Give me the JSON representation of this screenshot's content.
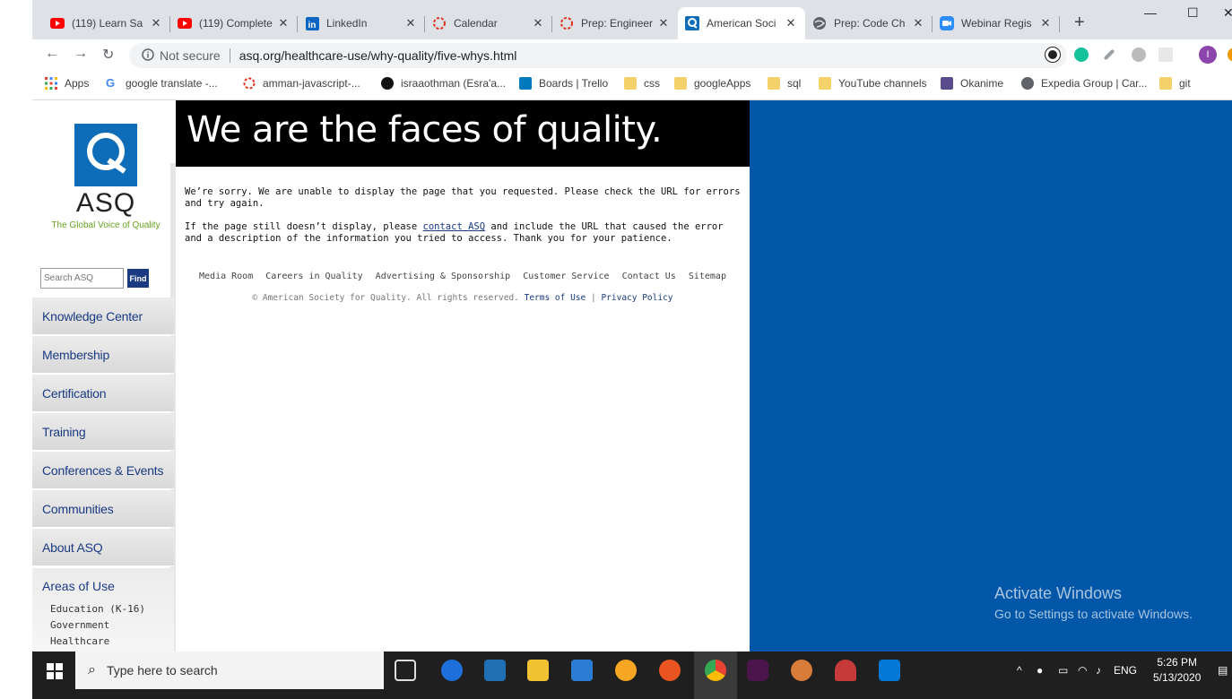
{
  "browser": {
    "tabs": [
      {
        "title": "(119) Learn Sa",
        "icon": "youtube-icon",
        "color": "#ff0000"
      },
      {
        "title": "(119) Complete",
        "icon": "youtube-icon",
        "color": "#ff0000"
      },
      {
        "title": "LinkedIn",
        "icon": "linkedin-icon",
        "color": "#0a66c2"
      },
      {
        "title": "Calendar",
        "icon": "hackerrank-icon",
        "color": "#e0301e"
      },
      {
        "title": "Prep: Engineer",
        "icon": "hackerrank-icon",
        "color": "#e0301e"
      },
      {
        "title": "American Soci",
        "icon": "asq-icon",
        "color": "#0d6db8"
      },
      {
        "title": "Prep: Code Ch",
        "icon": "globe-icon",
        "color": "#5f6368"
      },
      {
        "title": "Webinar Regis",
        "icon": "zoom-icon",
        "color": "#2d8cff"
      }
    ],
    "new_tab": "+",
    "window_controls": {
      "minimize": "—",
      "maximize": "☐",
      "close": "✕"
    },
    "not_secure": "Not secure",
    "url": "asq.org/healthcare-use/why-quality/five-whys.html",
    "bookmarks": [
      {
        "label": "Apps",
        "icon": "apps-grid-icon"
      },
      {
        "label": "google translate -...",
        "icon": "google-icon"
      },
      {
        "label": "amman-javascript-...",
        "icon": "hackerrank-icon"
      },
      {
        "label": "israaothman (Esra'a...",
        "icon": "github-icon"
      },
      {
        "label": "Boards | Trello",
        "icon": "trello-icon"
      },
      {
        "label": "css",
        "icon": "folder-icon"
      },
      {
        "label": "googleApps",
        "icon": "folder-icon"
      },
      {
        "label": "sql",
        "icon": "folder-icon"
      },
      {
        "label": "YouTube channels",
        "icon": "folder-icon"
      },
      {
        "label": "Okanime",
        "icon": "okanime-icon"
      },
      {
        "label": "Expedia Group | Car...",
        "icon": "globe-icon"
      },
      {
        "label": "git",
        "icon": "folder-icon"
      }
    ]
  },
  "site": {
    "logo_word": "ASQ",
    "logo_tagline": "The Global Voice of Quality",
    "search_placeholder": "Search ASQ",
    "search_button": "Find",
    "nav": [
      "Knowledge Center",
      "Membership",
      "Certification",
      "Training",
      "Conferences & Events",
      "Communities",
      "About ASQ"
    ],
    "areas_heading": "Areas of Use",
    "areas_items": [
      "Education (K-16)",
      "Government",
      "Healthcare"
    ],
    "banner": "We are the faces of quality.",
    "error_line1": "We’re sorry. We are unable to display the page that you requested. Please check the URL for errors and try again.",
    "error_line2_pre": "If the page still doesn’t display, please ",
    "error_link": "contact ASQ",
    "error_line2_post": " and include the URL that caused the error and a description of the information you tried to access. Thank you for your patience.",
    "footer_links": [
      "Media Room",
      "Careers in Quality",
      "Advertising & Sponsorship",
      "Customer Service",
      "Contact Us",
      "Sitemap"
    ],
    "copyright": "© American Society for Quality. All rights reserved.",
    "terms": "Terms of Use",
    "privacy": "Privacy Policy",
    "divider": "|"
  },
  "watermark": {
    "title": "Activate Windows",
    "subtitle": "Go to Settings to activate Windows."
  },
  "taskbar": {
    "search_placeholder": "Type here to search",
    "lang": "ENG",
    "time": "5:26 PM",
    "date": "5/13/2020"
  },
  "colors": {
    "asq_blue": "#0d6db8",
    "nav_text": "#1a3a82",
    "page_blue": "#0057a8",
    "tagline_green": "#6aa121"
  }
}
